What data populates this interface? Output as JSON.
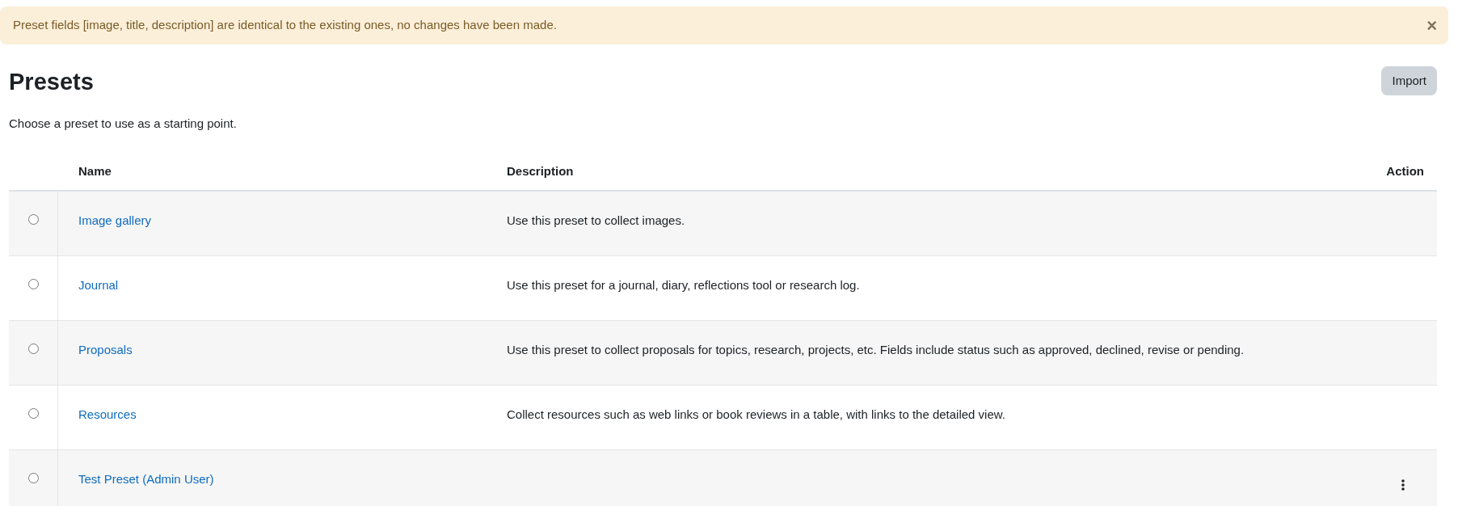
{
  "alert": {
    "message": "Preset fields [image, title, description] are identical to the existing ones, no changes have been made.",
    "close": "×"
  },
  "heading": "Presets",
  "import_button": "Import",
  "intro": "Choose a preset to use as a starting point.",
  "table": {
    "columns": [
      "Name",
      "Description",
      "Action"
    ],
    "rows": [
      {
        "selected": false,
        "name": "Image gallery",
        "description": "Use this preset to collect images.",
        "actions_menu": false
      },
      {
        "selected": false,
        "name": "Journal",
        "description": "Use this preset for a journal, diary, reflections tool or research log.",
        "actions_menu": false
      },
      {
        "selected": false,
        "name": "Proposals",
        "description": "Use this preset to collect proposals for topics, research, projects, etc. Fields include status such as approved, declined, revise or pending.",
        "actions_menu": false
      },
      {
        "selected": false,
        "name": "Resources",
        "description": "Collect resources such as web links or book reviews in a table, with links to the detailed view.",
        "actions_menu": false
      },
      {
        "selected": false,
        "name": "Test Preset (Admin User)",
        "actions_menu": true
      }
    ]
  }
}
